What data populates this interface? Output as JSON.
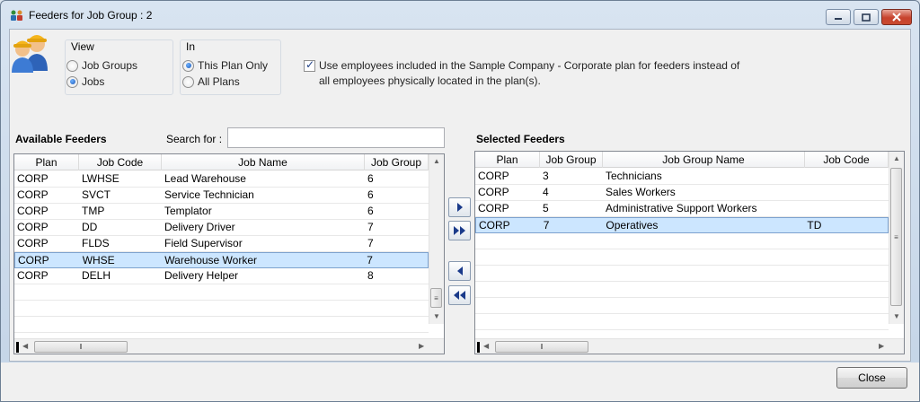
{
  "window": {
    "title": "Feeders for Job Group : 2",
    "controls": {
      "minimize": "minimize-icon",
      "maximize": "maximize-icon",
      "close": "close-icon"
    }
  },
  "view": {
    "label": "View",
    "options": [
      {
        "label": "Job Groups",
        "selected": false
      },
      {
        "label": "Jobs",
        "selected": true
      }
    ]
  },
  "scope": {
    "label": "In",
    "options": [
      {
        "label": "This Plan Only",
        "selected": true
      },
      {
        "label": "All Plans",
        "selected": false
      }
    ]
  },
  "corporate_option": {
    "checked": true,
    "line1": "Use employees included in the Sample Company - Corporate plan for feeders instead of",
    "line2": "all employees physically located in the plan(s)."
  },
  "available": {
    "title": "Available Feeders",
    "search_label": "Search for :",
    "search_value": "",
    "columns": [
      "Plan",
      "Job Code",
      "Job Name",
      "Job Group"
    ],
    "rows": [
      {
        "plan": "CORP",
        "code": "LWHSE",
        "name": "Lead Warehouse",
        "group": "6",
        "selected": false
      },
      {
        "plan": "CORP",
        "code": "SVCT",
        "name": "Service Technician",
        "group": "6",
        "selected": false
      },
      {
        "plan": "CORP",
        "code": "TMP",
        "name": "Templator",
        "group": "6",
        "selected": false
      },
      {
        "plan": "CORP",
        "code": "DD",
        "name": "Delivery Driver",
        "group": "7",
        "selected": false
      },
      {
        "plan": "CORP",
        "code": "FLDS",
        "name": "Field Supervisor",
        "group": "7",
        "selected": false
      },
      {
        "plan": "CORP",
        "code": "WHSE",
        "name": "Warehouse Worker",
        "group": "7",
        "selected": true
      },
      {
        "plan": "CORP",
        "code": "DELH",
        "name": "Delivery Helper",
        "group": "8",
        "selected": false
      }
    ]
  },
  "selected": {
    "title": "Selected Feeders",
    "columns": [
      "Plan",
      "Job Group",
      "Job Group Name",
      "Job Code"
    ],
    "rows": [
      {
        "plan": "CORP",
        "group": "3",
        "name": "Technicians",
        "code": "",
        "selected": false
      },
      {
        "plan": "CORP",
        "group": "4",
        "name": "Sales Workers",
        "code": "",
        "selected": false
      },
      {
        "plan": "CORP",
        "group": "5",
        "name": "Administrative Support Workers",
        "code": "",
        "selected": false
      },
      {
        "plan": "CORP",
        "group": "7",
        "name": "Operatives",
        "code": "TD",
        "selected": true
      }
    ]
  },
  "transfer_buttons": [
    "move-right-icon",
    "move-all-right-icon",
    "move-left-icon",
    "move-all-left-icon"
  ],
  "footer": {
    "close_label": "Close"
  },
  "colors": {
    "selection": "#cce6ff",
    "accent": "#1a3a8a"
  }
}
